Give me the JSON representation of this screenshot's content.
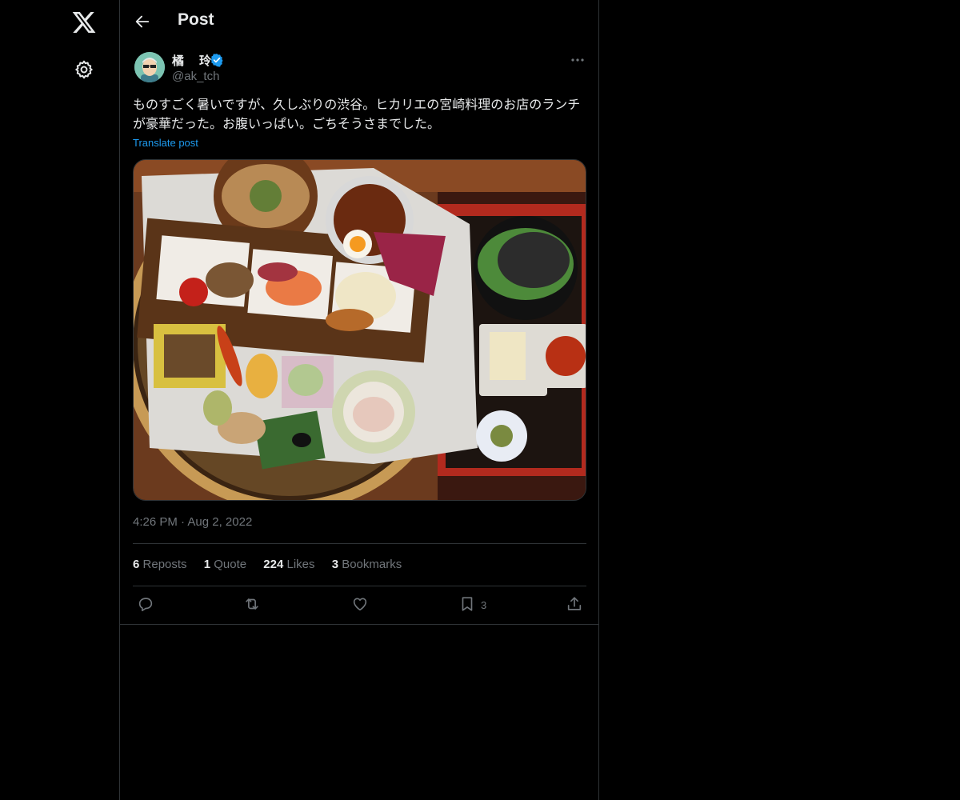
{
  "nav": {
    "logo_icon": "x-logo-icon",
    "settings_icon": "gear-icon"
  },
  "header": {
    "back_icon": "arrow-left-icon",
    "title": "Post"
  },
  "post": {
    "author": {
      "name": "橘　玲",
      "handle": "@ak_tch",
      "verified": true
    },
    "text": "ものすごく暑いですが、久しぶりの渋谷。ヒカリエの宮崎料理のお店のランチが豪華だった。お腹いっぱい。ごちそうさまでした。",
    "translate_label": "Translate post",
    "time": "4:26 PM",
    "separator": "·",
    "date": "Aug 2, 2022",
    "stats": {
      "reposts_count": "6",
      "reposts_label": "Reposts",
      "quotes_count": "1",
      "quotes_label": "Quote",
      "likes_count": "224",
      "likes_label": "Likes",
      "bookmarks_count": "3",
      "bookmarks_label": "Bookmarks"
    },
    "actions": {
      "reply_icon": "reply-icon",
      "repost_icon": "repost-icon",
      "like_icon": "heart-icon",
      "bookmark_icon": "bookmark-icon",
      "bookmark_count": "3",
      "share_icon": "share-icon"
    }
  },
  "colors": {
    "background": "#000000",
    "border": "#2f3336",
    "text_primary": "#e7e9ea",
    "text_secondary": "#71767b",
    "accent": "#1d9bf0"
  }
}
